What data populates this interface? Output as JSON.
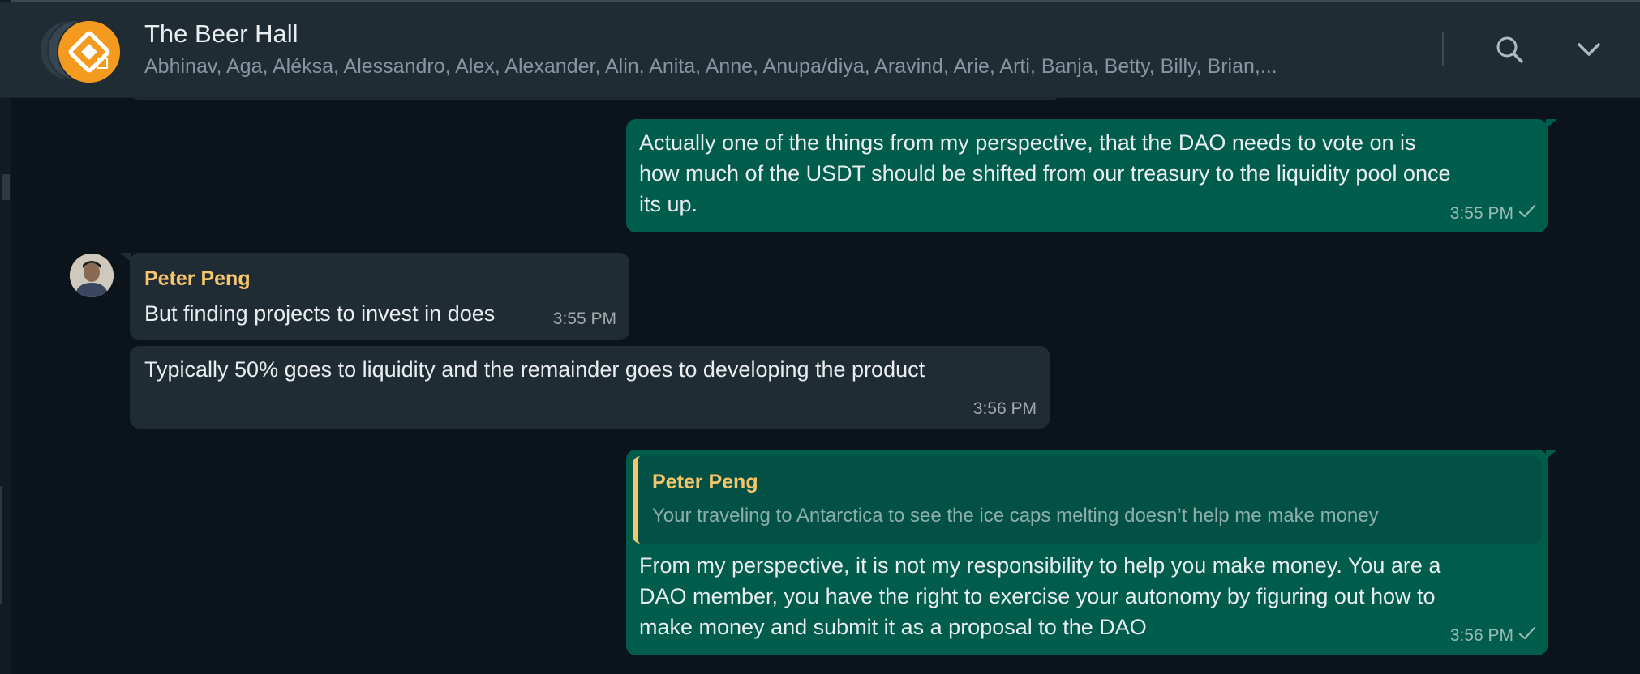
{
  "header": {
    "title": "The Beer Hall",
    "members": "Abhinav, Aga, Aléksa, Alessandro, Alex, Alexander, Alin, Anita, Anne, Anupa/diya, Aravind, Arie, Arti, Banja, Betty, Billy, Brian,...",
    "icons": [
      "group-avatar-icon",
      "search-icon",
      "chevron-down-icon"
    ]
  },
  "messages": [
    {
      "direction": "outgoing",
      "text_lines": [
        "Actually one of the things from my perspective, that the DAO needs to vote on is",
        "how much of the USDT should be shifted from our treasury to the liquidity pool once",
        "its up."
      ],
      "time": "3:55 PM",
      "status": "sent"
    },
    {
      "direction": "incoming",
      "sender": "Peter Peng",
      "text": "But finding projects to invest in does",
      "time": "3:55 PM"
    },
    {
      "direction": "incoming",
      "text": "Typically 50% goes to liquidity and the remainder goes to developing the product",
      "time": "3:56 PM"
    },
    {
      "direction": "outgoing",
      "quote": {
        "sender": "Peter Peng",
        "text": "Your traveling to Antarctica to see the ice caps melting doesn’t help me make money"
      },
      "text_lines": [
        "From my perspective, it is not my responsibility to help you make money. You are a",
        "DAO member, you have the right to exercise your autonomy by figuring out how to",
        "make money and submit it as a proposal to the DAO"
      ],
      "time": "3:56 PM",
      "status": "sent"
    }
  ],
  "colors": {
    "background": "#0b141a",
    "header": "#202c33",
    "outgoing_bubble": "#005c4b",
    "incoming_bubble": "#202c33",
    "sender_name": "#f7c56b",
    "group_avatar": "#f39a1f"
  }
}
